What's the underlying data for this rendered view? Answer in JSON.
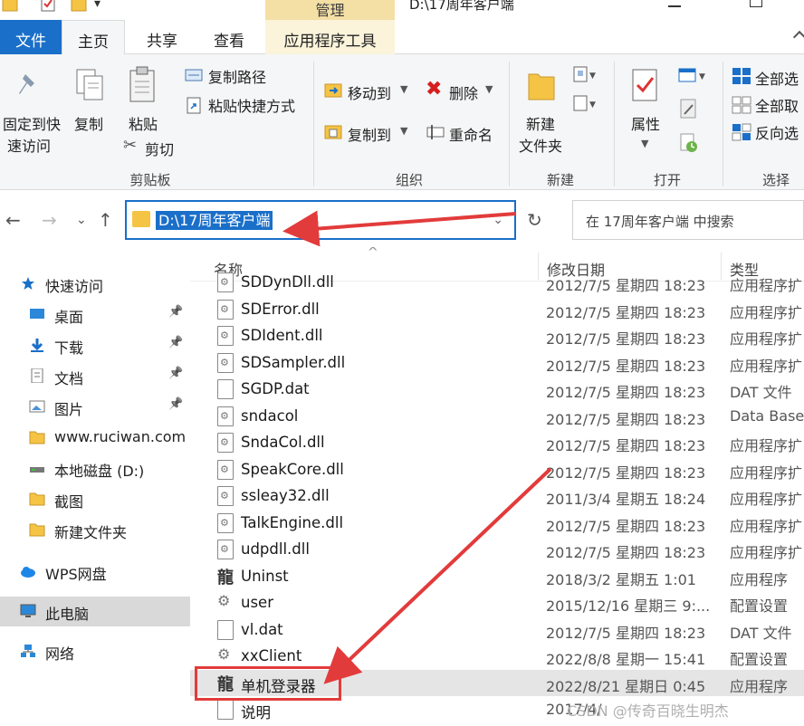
{
  "title_bar": {
    "context_tab": "管理",
    "path": "D:\\17周年客户端"
  },
  "tabs": [
    "文件",
    "主页",
    "共享",
    "查看",
    "应用程序工具"
  ],
  "ribbon": {
    "clipboard": {
      "pin_line1": "固定到快",
      "pin_line2": "速访问",
      "copy": "复制",
      "paste": "粘贴",
      "copy_path": "复制路径",
      "paste_shortcut": "粘贴快捷方式",
      "cut": "剪切",
      "label": "剪贴板"
    },
    "organize": {
      "move_to": "移动到",
      "copy_to": "复制到",
      "delete": "删除",
      "rename": "重命名",
      "label": "组织"
    },
    "new": {
      "new_folder_line1": "新建",
      "new_folder_line2": "文件夹",
      "label": "新建"
    },
    "open": {
      "properties": "属性",
      "label": "打开"
    },
    "select": {
      "select_all": "全部选",
      "select_none": "全部取",
      "invert": "反向选",
      "label": "选择"
    }
  },
  "address": {
    "path": "D:\\17周年客户端",
    "search_placeholder": "在 17周年客户端 中搜索"
  },
  "sidebar": [
    {
      "label": "快速访问",
      "icon": "star-icon",
      "indent": 0,
      "pinned": false
    },
    {
      "label": "桌面",
      "icon": "desktop-icon",
      "indent": 1,
      "pinned": true
    },
    {
      "label": "下载",
      "icon": "download-icon",
      "indent": 1,
      "pinned": true
    },
    {
      "label": "文档",
      "icon": "document-icon",
      "indent": 1,
      "pinned": true
    },
    {
      "label": "图片",
      "icon": "picture-icon",
      "indent": 1,
      "pinned": true
    },
    {
      "label": "www.ruciwan.com",
      "icon": "folder-icon",
      "indent": 1,
      "pinned": false
    },
    {
      "label": "本地磁盘 (D:)",
      "icon": "drive-icon",
      "indent": 1,
      "pinned": false
    },
    {
      "label": "截图",
      "icon": "folder-icon",
      "indent": 1,
      "pinned": false
    },
    {
      "label": "新建文件夹",
      "icon": "folder-icon",
      "indent": 1,
      "pinned": false
    },
    {
      "label": "WPS网盘",
      "icon": "cloud-icon",
      "indent": 0,
      "pinned": false
    },
    {
      "label": "此电脑",
      "icon": "computer-icon",
      "indent": 0,
      "pinned": false,
      "selected": true
    },
    {
      "label": "网络",
      "icon": "network-icon",
      "indent": 0,
      "pinned": false
    }
  ],
  "columns": {
    "name": "名称",
    "date": "修改日期",
    "type": "类型"
  },
  "files": [
    {
      "name": "SDDynDll.dll",
      "date": "2012/7/5 星期四 18:23",
      "type": "应用程序扩",
      "icon": "dll"
    },
    {
      "name": "SDError.dll",
      "date": "2012/7/5 星期四 18:23",
      "type": "应用程序扩",
      "icon": "dll"
    },
    {
      "name": "SDIdent.dll",
      "date": "2012/7/5 星期四 18:23",
      "type": "应用程序扩",
      "icon": "dll"
    },
    {
      "name": "SDSampler.dll",
      "date": "2012/7/5 星期四 18:23",
      "type": "应用程序扩",
      "icon": "dll"
    },
    {
      "name": "SGDP.dat",
      "date": "2012/7/5 星期四 18:23",
      "type": "DAT 文件",
      "icon": "file"
    },
    {
      "name": "sndacol",
      "date": "2012/7/5 星期四 18:23",
      "type": "Data Base",
      "icon": "dll"
    },
    {
      "name": "SndaCol.dll",
      "date": "2012/7/5 星期四 18:23",
      "type": "应用程序扩",
      "icon": "dll"
    },
    {
      "name": "SpeakCore.dll",
      "date": "2012/7/5 星期四 18:23",
      "type": "应用程序扩",
      "icon": "dll"
    },
    {
      "name": "ssleay32.dll",
      "date": "2011/3/4 星期五 18:24",
      "type": "应用程序扩",
      "icon": "dll"
    },
    {
      "name": "TalkEngine.dll",
      "date": "2012/7/5 星期四 18:23",
      "type": "应用程序扩",
      "icon": "dll"
    },
    {
      "name": "udpdll.dll",
      "date": "2012/7/5 星期四 18:23",
      "type": "应用程序扩",
      "icon": "dll"
    },
    {
      "name": "Uninst",
      "date": "2018/3/2 星期五 1:01",
      "type": "应用程序",
      "icon": "app"
    },
    {
      "name": "user",
      "date": "2015/12/16 星期三 9:...",
      "type": "配置设置",
      "icon": "cfg"
    },
    {
      "name": "vl.dat",
      "date": "2012/7/5 星期四 18:23",
      "type": "DAT 文件",
      "icon": "file"
    },
    {
      "name": "xxClient",
      "date": "2022/8/8 星期一 15:41",
      "type": "配置设置",
      "icon": "cfg"
    },
    {
      "name": "单机登录器",
      "date": "2022/8/21 星期日 0:45",
      "type": "应用程序",
      "icon": "app",
      "selected": true
    },
    {
      "name": "说明",
      "date": "2017/4/",
      "type": "",
      "icon": "file"
    }
  ],
  "watermark": "CSDN @传奇百晓生明杰",
  "colors": {
    "accent": "#1a6fc9",
    "annotation": "#e23b3b",
    "context_tab": "#f4dfa5"
  }
}
